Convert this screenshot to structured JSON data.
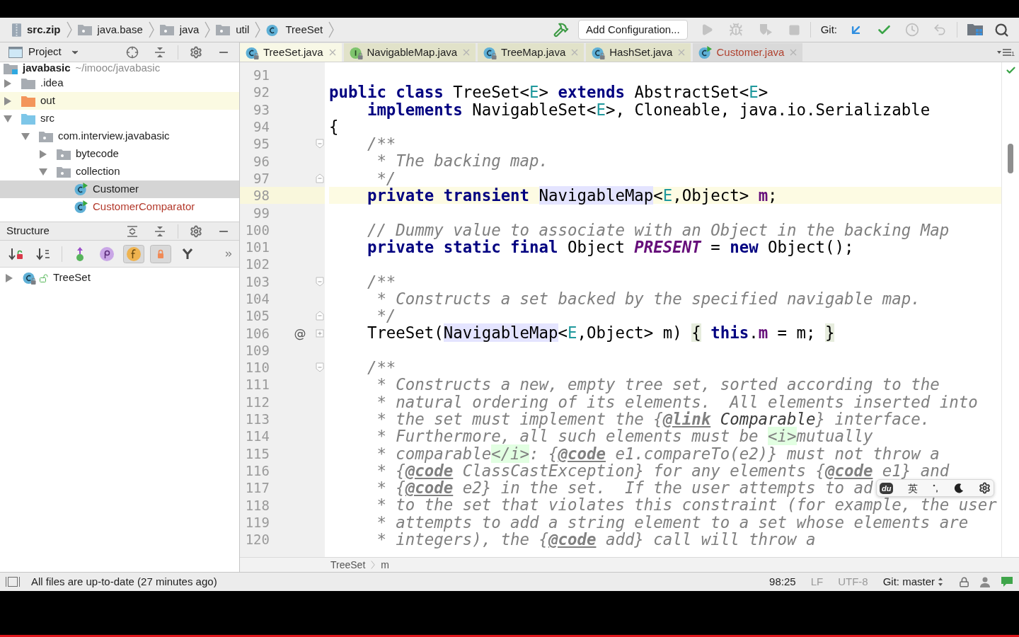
{
  "toolbar": {
    "breadcrumbs": [
      {
        "label": "src.zip",
        "kind": "archive",
        "bold": true
      },
      {
        "label": "java.base",
        "kind": "folder",
        "bold": false
      },
      {
        "label": "java",
        "kind": "folder",
        "bold": false
      },
      {
        "label": "util",
        "kind": "folder",
        "bold": false
      },
      {
        "label": "TreeSet",
        "kind": "class",
        "bold": false
      }
    ],
    "build": {
      "disabled": false
    },
    "run_configuration": "Add Configuration...",
    "run_actions": [
      {
        "kind": "run",
        "disabled": true
      },
      {
        "kind": "debug",
        "disabled": true
      },
      {
        "kind": "coverage",
        "disabled": true
      },
      {
        "kind": "stop",
        "disabled": true
      }
    ],
    "git_label": "Git:"
  },
  "project_panel": {
    "title": "Project",
    "tree": [
      {
        "label": "javabasic",
        "path": "~/imooc/javabasic",
        "kind": "module",
        "selected": false,
        "highlighted": false,
        "unversioned": false,
        "children": [
          {
            "label": ".idea",
            "kind": "folder",
            "expanded": false,
            "selected": false,
            "highlighted": false,
            "unversioned": false
          },
          {
            "label": "out",
            "kind": "excluded_folder",
            "expanded": false,
            "selected": false,
            "highlighted": true,
            "unversioned": false
          },
          {
            "label": "src",
            "kind": "source_folder",
            "expanded": true,
            "selected": false,
            "highlighted": false,
            "unversioned": false,
            "children": [
              {
                "label": "com.interview.javabasic",
                "kind": "package",
                "expanded": true,
                "selected": false,
                "highlighted": false,
                "unversioned": false,
                "children": [
                  {
                    "label": "bytecode",
                    "kind": "package",
                    "expanded": false,
                    "selected": false,
                    "highlighted": false,
                    "unversioned": false
                  },
                  {
                    "label": "collection",
                    "kind": "package",
                    "expanded": true,
                    "selected": false,
                    "highlighted": false,
                    "unversioned": false,
                    "children": [
                      {
                        "label": "Customer",
                        "kind": "class",
                        "runnable": true,
                        "selected": true,
                        "highlighted": false,
                        "unversioned": false
                      },
                      {
                        "label": "CustomerComparator",
                        "kind": "class",
                        "runnable": true,
                        "selected": false,
                        "highlighted": false,
                        "unversioned": true
                      }
                    ]
                  }
                ]
              }
            ]
          }
        ]
      }
    ]
  },
  "structure_panel": {
    "title": "Structure",
    "tools": [
      {
        "kind": "sort_by_visibility",
        "toggled": false
      },
      {
        "kind": "sort_alphabetically",
        "toggled": false
      },
      {
        "kind": "show_inherited",
        "toggled": false
      },
      {
        "kind": "properties",
        "toggled": false
      },
      {
        "kind": "fields",
        "toggled": true
      },
      {
        "kind": "non_public",
        "toggled": true
      },
      {
        "kind": "lambdas",
        "toggled": false
      }
    ],
    "tree": [
      {
        "label": "TreeSet",
        "kind": "class",
        "library": true,
        "public": true,
        "expanded": false,
        "selected": false,
        "highlighted": false,
        "unversioned": false
      }
    ]
  },
  "editor": {
    "tabs": [
      {
        "label": "TreeSet.java",
        "kind": "class",
        "library": true,
        "runnable": false,
        "unversioned": false,
        "selected": true
      },
      {
        "label": "NavigableMap.java",
        "kind": "interface",
        "library": true,
        "runnable": false,
        "unversioned": false,
        "selected": false
      },
      {
        "label": "TreeMap.java",
        "kind": "class",
        "library": true,
        "runnable": false,
        "unversioned": false,
        "selected": false
      },
      {
        "label": "HashSet.java",
        "kind": "class",
        "library": true,
        "runnable": false,
        "unversioned": false,
        "selected": false
      },
      {
        "label": "Customer.java",
        "kind": "class",
        "library": false,
        "runnable": true,
        "unversioned": true,
        "selected": false
      }
    ],
    "hidden_tab_count": "1",
    "lines": [
      {
        "number": "91",
        "current": false
      },
      {
        "number": "92",
        "current": false,
        "tokens": [
          {
            "text": "public class",
            "kind": "keyword"
          },
          {
            "text": " TreeSet<",
            "kind": "plain"
          },
          {
            "text": "E",
            "kind": "type_param"
          },
          {
            "text": "> ",
            "kind": "plain"
          },
          {
            "text": "extends",
            "kind": "keyword"
          },
          {
            "text": " AbstractSet<",
            "kind": "plain"
          },
          {
            "text": "E",
            "kind": "type_param"
          },
          {
            "text": ">",
            "kind": "plain"
          }
        ]
      },
      {
        "number": "93",
        "current": false,
        "tokens": [
          {
            "text": "    implements",
            "kind": "keyword"
          },
          {
            "text": " NavigableSet<",
            "kind": "plain"
          },
          {
            "text": "E",
            "kind": "type_param"
          },
          {
            "text": ">, Cloneable, java.io.Serializable",
            "kind": "plain"
          }
        ]
      },
      {
        "number": "94",
        "current": false,
        "tokens": [
          {
            "text": "{",
            "kind": "plain"
          }
        ]
      },
      {
        "number": "95",
        "current": false,
        "fold_marker": {
          "kind": "start"
        },
        "tokens": [
          {
            "text": "    /**",
            "kind": "comment"
          }
        ]
      },
      {
        "number": "96",
        "current": false,
        "tokens": [
          {
            "text": "     * The backing map.",
            "kind": "comment"
          }
        ]
      },
      {
        "number": "97",
        "current": false,
        "fold_marker": {
          "kind": "end"
        },
        "tokens": [
          {
            "text": "     */",
            "kind": "comment"
          }
        ]
      },
      {
        "number": "98",
        "current": true,
        "tokens": [
          {
            "text": "    private transient ",
            "kind": "keyword"
          },
          {
            "text": "NavigableMap",
            "kind": "usage"
          },
          {
            "text": "<",
            "kind": "plain"
          },
          {
            "text": "E",
            "kind": "type_param"
          },
          {
            "text": ",Object> ",
            "kind": "plain"
          },
          {
            "text": "m",
            "kind": "field"
          },
          {
            "text": ";",
            "kind": "plain"
          }
        ]
      },
      {
        "number": "99",
        "current": false
      },
      {
        "number": "100",
        "current": false,
        "tokens": [
          {
            "text": "    // Dummy value to associate with an Object in the backing Map",
            "kind": "comment"
          }
        ]
      },
      {
        "number": "101",
        "current": false,
        "tokens": [
          {
            "text": "    private static final",
            "kind": "keyword"
          },
          {
            "text": " Object ",
            "kind": "plain"
          },
          {
            "text": "PRESENT",
            "kind": "constant"
          },
          {
            "text": " = ",
            "kind": "plain"
          },
          {
            "text": "new",
            "kind": "keyword"
          },
          {
            "text": " Object();",
            "kind": "plain"
          }
        ]
      },
      {
        "number": "102",
        "current": false
      },
      {
        "number": "103",
        "current": false,
        "fold_marker": {
          "kind": "start"
        },
        "tokens": [
          {
            "text": "    /**",
            "kind": "comment"
          }
        ]
      },
      {
        "number": "104",
        "current": false,
        "tokens": [
          {
            "text": "     * Constructs a set backed by the specified navigable map.",
            "kind": "comment"
          }
        ]
      },
      {
        "number": "105",
        "current": false,
        "fold_marker": {
          "kind": "end"
        },
        "tokens": [
          {
            "text": "     */",
            "kind": "comment"
          }
        ]
      },
      {
        "number": "106",
        "current": false,
        "marker": "@",
        "fold_marker": {
          "kind": "collapsed"
        },
        "tokens": [
          {
            "text": "    TreeSet(",
            "kind": "plain"
          },
          {
            "text": "NavigableMap",
            "kind": "usage"
          },
          {
            "text": "<",
            "kind": "plain"
          },
          {
            "text": "E",
            "kind": "type_param"
          },
          {
            "text": ",Object> m) ",
            "kind": "plain"
          },
          {
            "text": "{",
            "kind": "fold_brace"
          },
          {
            "text": " this",
            "kind": "keyword"
          },
          {
            "text": ".",
            "kind": "plain"
          },
          {
            "text": "m",
            "kind": "field"
          },
          {
            "text": " = m; ",
            "kind": "plain"
          },
          {
            "text": "}",
            "kind": "fold_brace"
          }
        ]
      },
      {
        "number": "109",
        "current": false
      },
      {
        "number": "110",
        "current": false,
        "fold_marker": {
          "kind": "start"
        },
        "tokens": [
          {
            "text": "    /**",
            "kind": "comment"
          }
        ]
      },
      {
        "number": "111",
        "current": false,
        "tokens": [
          {
            "text": "     * Constructs a new, empty tree set, sorted according to the",
            "kind": "comment"
          }
        ]
      },
      {
        "number": "112",
        "current": false,
        "tokens": [
          {
            "text": "     * natural ordering of its elements.  All elements inserted into",
            "kind": "comment"
          }
        ]
      },
      {
        "number": "113",
        "current": false,
        "tokens": [
          {
            "text": "     * the set must implement the {",
            "kind": "comment"
          },
          {
            "text": "@link",
            "kind": "doc_tag"
          },
          {
            "text": " Comparable",
            "kind": "doc_ref"
          },
          {
            "text": "} interface.",
            "kind": "comment"
          }
        ]
      },
      {
        "number": "114",
        "current": false,
        "tokens": [
          {
            "text": "     * Furthermore, all such elements must be ",
            "kind": "comment"
          },
          {
            "text": "<i>",
            "kind": "html_tag"
          },
          {
            "text": "mutually",
            "kind": "comment"
          }
        ]
      },
      {
        "number": "115",
        "current": false,
        "tokens": [
          {
            "text": "     * comparable",
            "kind": "comment"
          },
          {
            "text": "</i>",
            "kind": "html_tag"
          },
          {
            "text": ": {",
            "kind": "comment"
          },
          {
            "text": "@code",
            "kind": "doc_tag"
          },
          {
            "text": " e1.compareTo(e2)} must not throw a",
            "kind": "comment"
          }
        ]
      },
      {
        "number": "116",
        "current": false,
        "tokens": [
          {
            "text": "     * {",
            "kind": "comment"
          },
          {
            "text": "@code",
            "kind": "doc_tag"
          },
          {
            "text": " ClassCastException} for any elements {",
            "kind": "comment"
          },
          {
            "text": "@code",
            "kind": "doc_tag"
          },
          {
            "text": " e1} and",
            "kind": "comment"
          }
        ]
      },
      {
        "number": "117",
        "current": false,
        "tokens": [
          {
            "text": "     * {",
            "kind": "comment"
          },
          {
            "text": "@code",
            "kind": "doc_tag"
          },
          {
            "text": " e2} in the set.  If the user attempts to ad",
            "kind": "comment"
          }
        ]
      },
      {
        "number": "118",
        "current": false,
        "tokens": [
          {
            "text": "     * to the set that violates this constraint (for example, the user",
            "kind": "comment"
          }
        ]
      },
      {
        "number": "119",
        "current": false,
        "tokens": [
          {
            "text": "     * attempts to add a string element to a set whose elements are",
            "kind": "comment"
          }
        ]
      },
      {
        "number": "120",
        "current": false,
        "tokens": [
          {
            "text": "     * integers), the {",
            "kind": "comment"
          },
          {
            "text": "@code",
            "kind": "doc_tag"
          },
          {
            "text": " add} call will throw a",
            "kind": "comment"
          }
        ]
      }
    ],
    "breadcrumbs": [
      "TreeSet",
      "m"
    ]
  },
  "input_method": {
    "logo": "du",
    "language": "英"
  },
  "status_bar": {
    "message": "All files are up-to-date (27 minutes ago)",
    "caret_position": "98:25",
    "line_separator": "LF",
    "encoding": "UTF-8",
    "branch": "Git: master"
  }
}
